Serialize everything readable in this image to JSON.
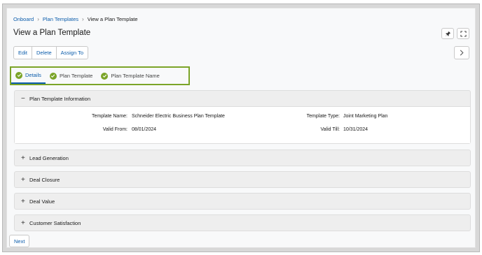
{
  "breadcrumb": {
    "items": [
      "Onboard",
      "Plan Templates"
    ],
    "current": "View a Plan Template"
  },
  "page_title": "View a Plan Template",
  "actions": {
    "edit": "Edit",
    "delete": "Delete",
    "assign_to": "Assign To"
  },
  "tabs": [
    {
      "label": "Details",
      "active": true,
      "completed": true
    },
    {
      "label": "Plan Template",
      "active": false,
      "completed": true
    },
    {
      "label": "Plan Template Name",
      "active": false,
      "completed": true
    }
  ],
  "plan_template_information": {
    "title": "Plan Template Information",
    "expanded": true,
    "template_name_label": "Template Name:",
    "template_name_value": "Schneider Electric Business Plan Template",
    "template_type_label": "Template Type:",
    "template_type_value": "Joint Marketing Plan",
    "valid_from_label": "Valid From:",
    "valid_from_value": "08/01/2024",
    "valid_till_label": "Valid Till:",
    "valid_till_value": "10/31/2024"
  },
  "sections": [
    {
      "title": "Lead Generation",
      "expanded": false
    },
    {
      "title": "Deal Closure",
      "expanded": false
    },
    {
      "title": "Deal Value",
      "expanded": false
    },
    {
      "title": "Customer Satisfaction",
      "expanded": false
    }
  ],
  "footer": {
    "next": "Next"
  },
  "colors": {
    "link": "#0b5cab",
    "success": "#7ba428",
    "highlight_border": "#7ba428"
  },
  "icons": {
    "pin": "pin-icon",
    "expand": "expand-icon",
    "next_arrow": "chevron-right-icon",
    "check": "check-circle-icon"
  }
}
